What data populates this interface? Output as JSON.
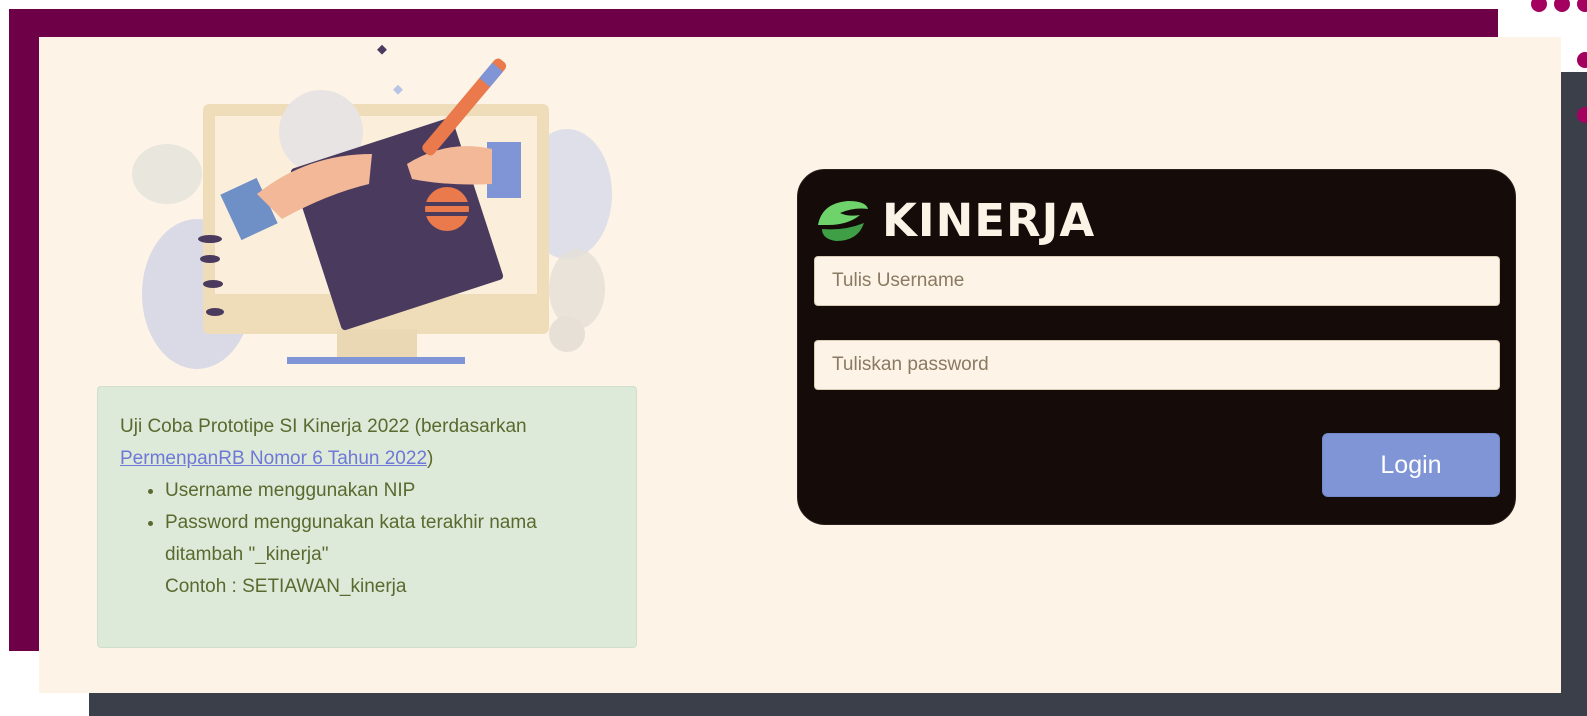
{
  "brand": {
    "logo_text": "KINERJA",
    "colors": {
      "primary": "#6e0047",
      "panel": "#fdf3e6",
      "card": "#150c0a",
      "button": "#7f95d6",
      "info_bg": "#dde9d9"
    }
  },
  "info": {
    "intro": "Uji Coba Prototipe SI Kinerja 2022 (berdasarkan ",
    "link_text": "PermenpanRB Nomor 6 Tahun 2022",
    "intro_end": ")",
    "items": [
      {
        "text": "Username menggunakan NIP"
      },
      {
        "text": "Password menggunakan kata terakhir nama ditambah \"_kinerja\"",
        "example": "Contoh : SETIAWAN_kinerja"
      }
    ]
  },
  "form": {
    "username_placeholder": "Tulis Username",
    "password_placeholder": "Tuliskan password",
    "login_label": "Login"
  }
}
